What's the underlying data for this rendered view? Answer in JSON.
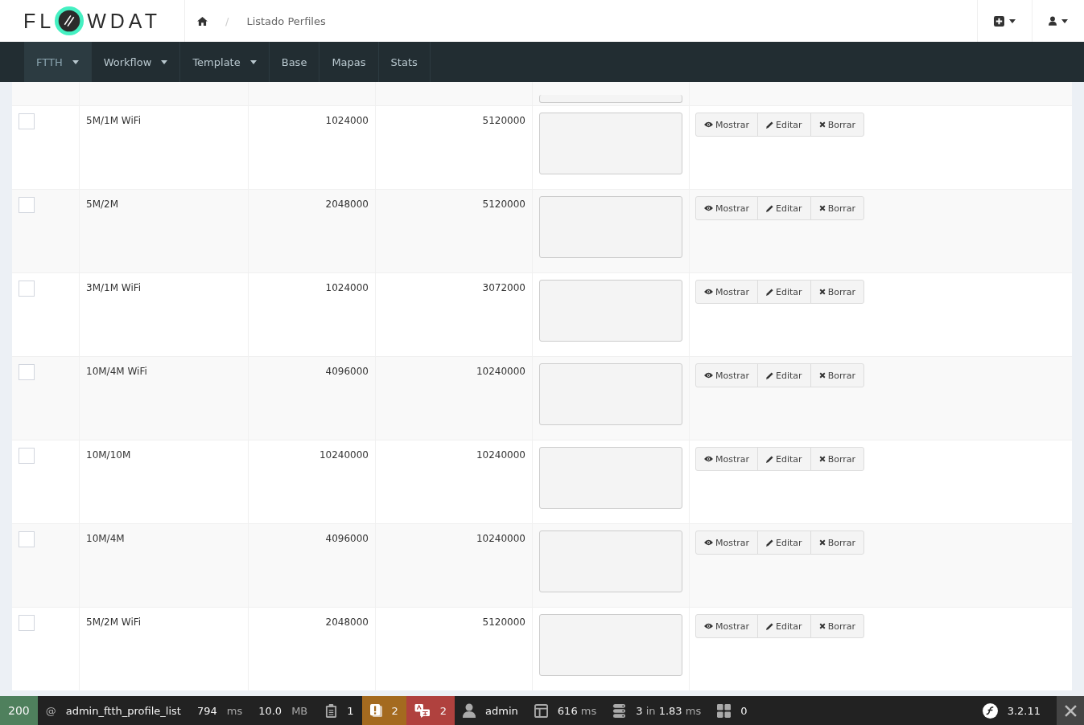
{
  "header": {
    "logo": {
      "left": "FL",
      "right": "WDAT"
    },
    "separator": "/",
    "breadcrumb": [
      "Listado Perfiles"
    ]
  },
  "nav": [
    {
      "label": "FTTH",
      "dropdown": true,
      "selected": true
    },
    {
      "label": "Workflow",
      "dropdown": true,
      "selected": false
    },
    {
      "label": "Template",
      "dropdown": true,
      "selected": false
    },
    {
      "label": "Base",
      "dropdown": false,
      "selected": false
    },
    {
      "label": "Mapas",
      "dropdown": false,
      "selected": false
    },
    {
      "label": "Stats",
      "dropdown": false,
      "selected": false
    }
  ],
  "rows": [
    {
      "checked": false,
      "name": "5M/1M WiFi",
      "column_3": "1024000",
      "column_4": "5120000",
      "actions": [
        "Mostrar",
        "Editar",
        "Borrar"
      ]
    },
    {
      "checked": false,
      "name": "5M/2M",
      "column_3": "2048000",
      "column_4": "5120000",
      "actions": [
        "Mostrar",
        "Editar",
        "Borrar"
      ]
    },
    {
      "checked": false,
      "name": "3M/1M WiFi",
      "column_3": "1024000",
      "column_4": "3072000",
      "actions": [
        "Mostrar",
        "Editar",
        "Borrar"
      ]
    },
    {
      "checked": false,
      "name": "10M/4M WiFi",
      "column_3": "4096000",
      "column_4": "10240000",
      "actions": [
        "Mostrar",
        "Editar",
        "Borrar"
      ]
    },
    {
      "checked": false,
      "name": "10M/10M",
      "column_3": "10240000",
      "column_4": "10240000",
      "actions": [
        "Mostrar",
        "Editar",
        "Borrar"
      ]
    },
    {
      "checked": false,
      "name": "10M/4M",
      "column_3": "4096000",
      "column_4": "10240000",
      "actions": [
        "Mostrar",
        "Editar",
        "Borrar"
      ]
    },
    {
      "checked": false,
      "name": "5M/2M WiFi",
      "column_3": "2048000",
      "column_4": "5120000",
      "actions": [
        "Mostrar",
        "Editar",
        "Borrar"
      ]
    }
  ],
  "toolbar": {
    "status": "200",
    "route_prefix": "@",
    "route": "admin_ftth_profile_list",
    "time": "794",
    "time_unit": "ms",
    "memory": "10.0",
    "memory_unit": "MB",
    "logs": "1",
    "warnings": "2",
    "translations": "2",
    "user": "admin",
    "timer": "616",
    "timer_unit": "ms",
    "queries": "3",
    "queries_in": "in",
    "query_time": "1.83",
    "query_unit": "ms",
    "forms": "0",
    "version": "3.2.11"
  }
}
